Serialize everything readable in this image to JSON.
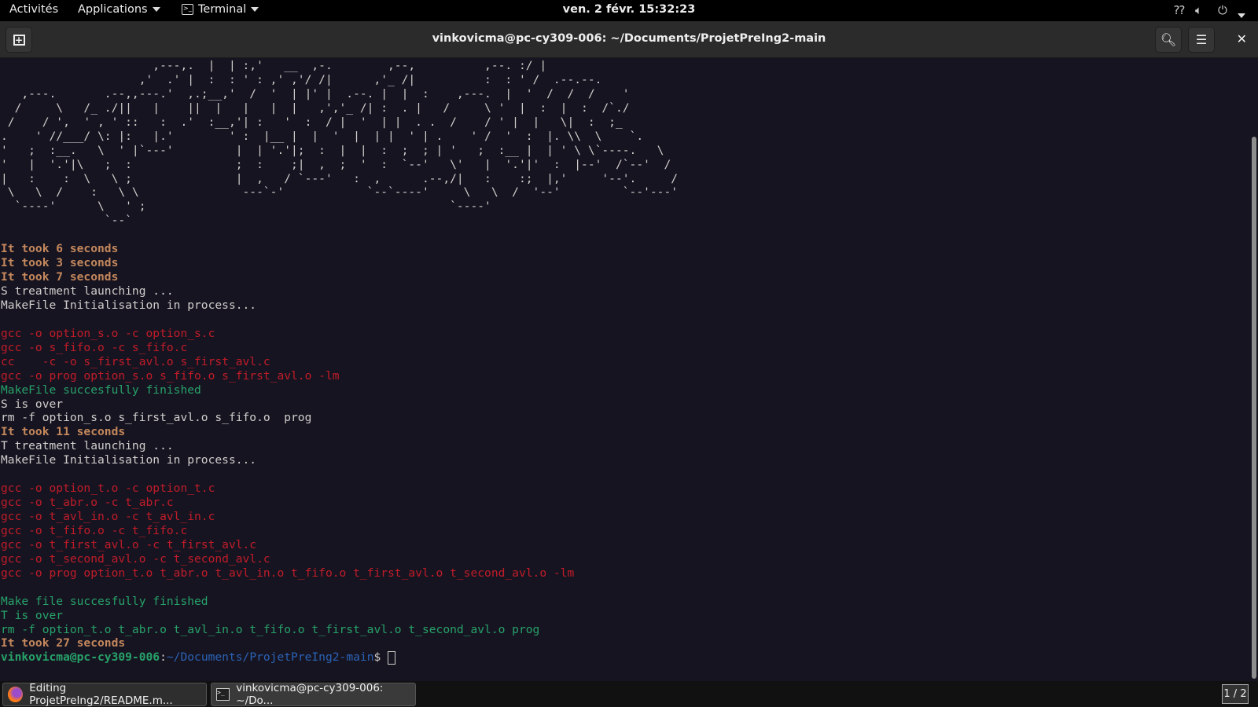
{
  "topbar": {
    "activities": "Activités",
    "applications": "Applications",
    "app_menu": "Terminal",
    "clock": "ven. 2 févr.  15:32:23"
  },
  "window": {
    "title": "vinkovicma@pc-cy309-006: ~/Documents/ProjetPreIng2-main"
  },
  "terminal": {
    "lines": [
      {
        "c": "a",
        "t": "                      ,---,.  |  | :,'   __  ,-.        ,--,          ,--. :/ |"
      },
      {
        "c": "a",
        "t": "                    ,'  .' |  :  : ' : ,' ,'/ /|      ,'_ /|          :  : ' /  .--.--."
      },
      {
        "c": "a",
        "t": "   ,---.       .--,,---.'  ,.;__,'  /  '  | |' |  .--. |  |  :    ,---.  |  '  /  /  /    '"
      },
      {
        "c": "a",
        "t": "  /     \\   /_ ./||   |    ||  |   |   |  |   ,','_ /| :  . |   /     \\ '  |  :  |  :  /`./"
      },
      {
        "c": "a",
        "t": " /    / ',  ' , ' ::   :  .'  :__,'| :   '  :  / |  '  | |  . .  /    / ' |  |   \\|  :  ;_"
      },
      {
        "c": "a",
        "t": ".    ' //___/ \\: |:   |.'        ' :  |__ |  |  '  |  | |  ' | .    ' /  '  :  |. \\\\  \\    `."
      },
      {
        "c": "a",
        "t": "'   ;  :__.   \\  ' |`---'         |  | '.'|;  :  |  |  :  ;  ; | '   ;  :__ |  | ' \\ \\`----.   \\"
      },
      {
        "c": "a",
        "t": "'   |  '.'|\\   ;  :               ;  :    ;|  ,  ;  '  :  `--'   \\'   |  '.'|'  :  |--'  /`--'  /"
      },
      {
        "c": "a",
        "t": "|   :    :  \\   \\ ;               |  ,   / `---'   :  ,      .--,/|   :    :;  |,'     '--'.     /"
      },
      {
        "c": "a",
        "t": " \\   \\  /    :   \\ \\               ---`-'            `--`----'     \\   \\  /  '--'         `--'---'"
      },
      {
        "c": "a",
        "t": "  `----'      \\   ' ;                                            `----'"
      },
      {
        "c": "a",
        "t": "               `--`"
      },
      {
        "c": "w",
        "t": ""
      },
      {
        "c": "o",
        "t": "It took 6 seconds"
      },
      {
        "c": "o",
        "t": "It took 3 seconds"
      },
      {
        "c": "o",
        "t": "It took 7 seconds"
      },
      {
        "c": "w",
        "t": "S treatment launching ..."
      },
      {
        "c": "w",
        "t": "MakeFile Initialisation in process..."
      },
      {
        "c": "w",
        "t": ""
      },
      {
        "c": "r",
        "t": "gcc -o option_s.o -c option_s.c"
      },
      {
        "c": "r",
        "t": "gcc -o s_fifo.o -c s_fifo.c"
      },
      {
        "c": "r",
        "t": "cc    -c -o s_first_avl.o s_first_avl.c"
      },
      {
        "c": "r",
        "t": "gcc -o prog option_s.o s_fifo.o s_first_avl.o -lm"
      },
      {
        "c": "g",
        "t": "MakeFile succesfully finished"
      },
      {
        "c": "w",
        "t": "S is over"
      },
      {
        "c": "w",
        "t": "rm -f option_s.o s_first_avl.o s_fifo.o  prog"
      },
      {
        "c": "o",
        "t": "It took 11 seconds"
      },
      {
        "c": "w",
        "t": "T treatment launching ..."
      },
      {
        "c": "w",
        "t": "MakeFile Initialisation in process..."
      },
      {
        "c": "w",
        "t": ""
      },
      {
        "c": "r",
        "t": "gcc -o option_t.o -c option_t.c"
      },
      {
        "c": "r",
        "t": "gcc -o t_abr.o -c t_abr.c"
      },
      {
        "c": "r",
        "t": "gcc -o t_avl_in.o -c t_avl_in.c"
      },
      {
        "c": "r",
        "t": "gcc -o t_fifo.o -c t_fifo.c"
      },
      {
        "c": "r",
        "t": "gcc -o t_first_avl.o -c t_first_avl.c"
      },
      {
        "c": "r",
        "t": "gcc -o t_second_avl.o -c t_second_avl.c"
      },
      {
        "c": "r",
        "t": "gcc -o prog option_t.o t_abr.o t_avl_in.o t_fifo.o t_first_avl.o t_second_avl.o -lm"
      },
      {
        "c": "w",
        "t": ""
      },
      {
        "c": "g",
        "t": "Make file succesfully finished"
      },
      {
        "c": "g",
        "t": "T is over"
      },
      {
        "c": "g",
        "t": "rm -f option_t.o t_abr.o t_avl_in.o t_fifo.o t_first_avl.o t_second_avl.o prog"
      },
      {
        "c": "o",
        "t": "It took 27 seconds"
      }
    ],
    "prompt": {
      "user": "vinkovicma@pc-cy309-006",
      "sep": ":",
      "path": "~/Documents/ProjetPreIng2-main",
      "symbol": "$ "
    }
  },
  "taskbar": {
    "tasks": [
      "Editing ProjetPreIng2/README.m...",
      "vinkovicma@pc-cy309-006: ~/Do..."
    ],
    "workspace": "1 / 2"
  }
}
